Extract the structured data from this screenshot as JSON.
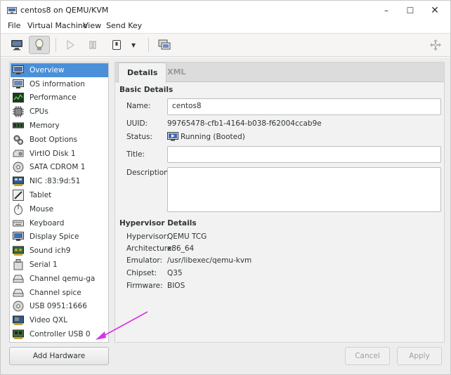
{
  "window": {
    "title": "centos8 on QEMU/KVM",
    "minimize_glyph": "–",
    "maximize_glyph": "☐",
    "close_glyph": "✕"
  },
  "menu": [
    "File",
    "Virtual Machine",
    "View",
    "Send Key"
  ],
  "toolbar": {
    "buttons": [
      "console-icon",
      "lightbulb-icon",
      "play-icon",
      "pause-icon",
      "power-icon",
      "dropdown-arrow-icon",
      "snapshots-icon",
      "fullscreen-icon"
    ],
    "dropdown_glyph": "▾"
  },
  "sidebar": {
    "items": [
      {
        "label": "Overview",
        "icon": "monitor-icon"
      },
      {
        "label": "OS information",
        "icon": "os-info-icon"
      },
      {
        "label": "Performance",
        "icon": "performance-graph-icon"
      },
      {
        "label": "CPUs",
        "icon": "cpu-chip-icon"
      },
      {
        "label": "Memory",
        "icon": "memory-module-icon"
      },
      {
        "label": "Boot Options",
        "icon": "gears-icon"
      },
      {
        "label": "VirtIO Disk 1",
        "icon": "hard-disk-icon"
      },
      {
        "label": "SATA CDROM 1",
        "icon": "cdrom-icon"
      },
      {
        "label": "NIC :83:9d:51",
        "icon": "network-card-icon"
      },
      {
        "label": "Tablet",
        "icon": "tablet-pen-icon"
      },
      {
        "label": "Mouse",
        "icon": "mouse-icon"
      },
      {
        "label": "Keyboard",
        "icon": "keyboard-icon"
      },
      {
        "label": "Display Spice",
        "icon": "display-icon"
      },
      {
        "label": "Sound ich9",
        "icon": "sound-card-icon"
      },
      {
        "label": "Serial 1",
        "icon": "serial-port-icon"
      },
      {
        "label": "Channel qemu-ga",
        "icon": "channel-icon"
      },
      {
        "label": "Channel spice",
        "icon": "channel-icon"
      },
      {
        "label": "USB 0951:1666",
        "icon": "usb-icon"
      },
      {
        "label": "Video QXL",
        "icon": "video-card-icon"
      },
      {
        "label": "Controller USB 0",
        "icon": "controller-icon"
      }
    ],
    "selected_index": 0
  },
  "tabs": {
    "details": "Details",
    "xml": "XML"
  },
  "basic_details": {
    "title": "Basic Details",
    "name_label": "Name:",
    "name_value": "centos8",
    "uuid_label": "UUID:",
    "uuid_value": "99765478-cfb1-4164-b038-f62004ccab9e",
    "status_label": "Status:",
    "status_value": "Running (Booted)",
    "title_label": "Title:",
    "title_value": "",
    "description_label": "Description:",
    "description_value": ""
  },
  "hypervisor_details": {
    "title": "Hypervisor Details",
    "hypervisor_label": "Hypervisor:",
    "hypervisor_value": "QEMU TCG",
    "architecture_label": "Architecture:",
    "architecture_value": "x86_64",
    "emulator_label": "Emulator:",
    "emulator_value": "/usr/libexec/qemu-kvm",
    "chipset_label": "Chipset:",
    "chipset_value": "Q35",
    "firmware_label": "Firmware:",
    "firmware_value": "BIOS"
  },
  "buttons": {
    "add_hardware": "Add Hardware",
    "cancel": "Cancel",
    "apply": "Apply"
  },
  "colors": {
    "selection": "#4a90d9",
    "annotation_arrow": "#d633e6"
  }
}
